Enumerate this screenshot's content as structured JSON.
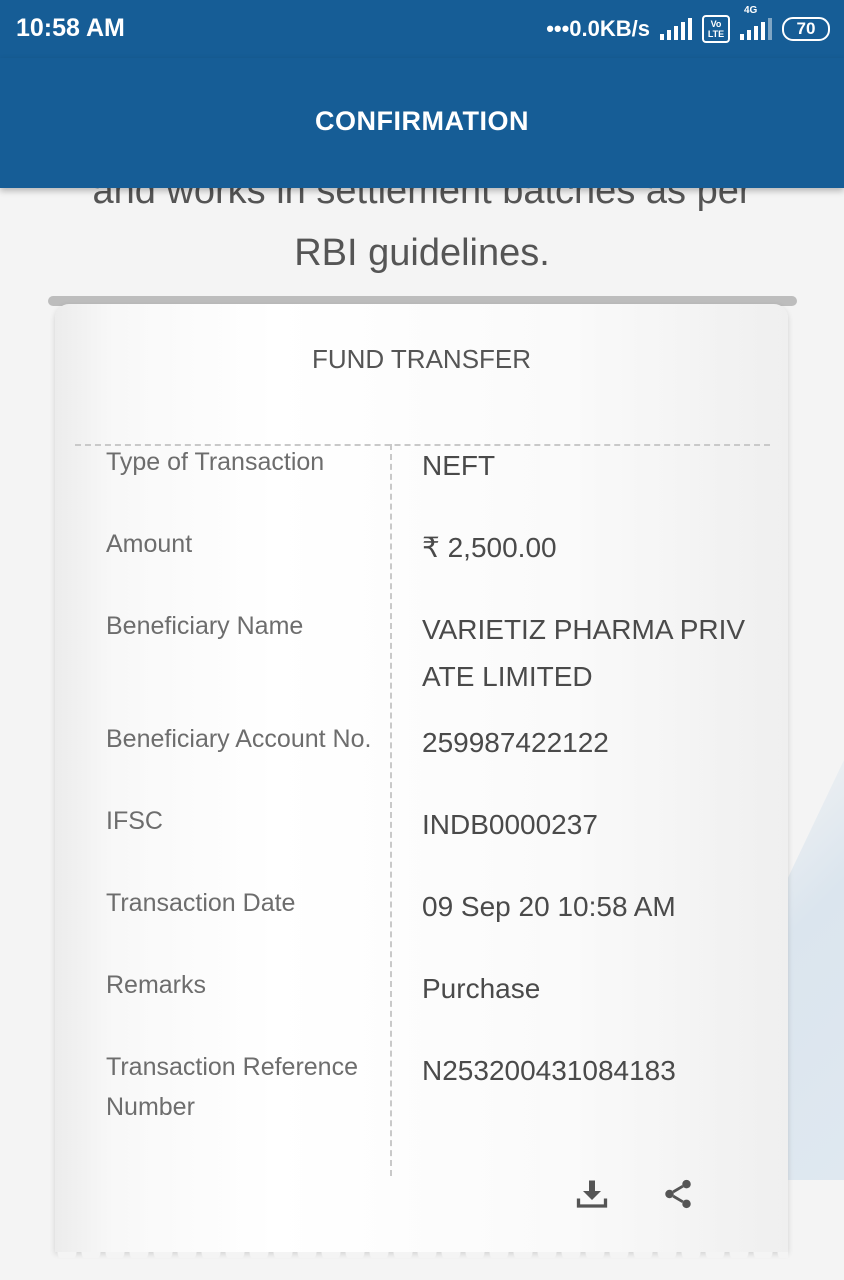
{
  "status_bar": {
    "time": "10:58 AM",
    "network_speed": "•••0.0KB/s",
    "volte_top": "Vo",
    "volte_bottom": "LTE",
    "network_type": "4G",
    "battery": "70"
  },
  "header": {
    "title": "CONFIRMATION"
  },
  "notice": {
    "line_partial": "and works in settlement batches as per",
    "line_last": "RBI guidelines."
  },
  "receipt": {
    "title": "FUND TRANSFER",
    "rows": [
      {
        "label": "Type of Transaction",
        "value": "NEFT"
      },
      {
        "label": "Amount",
        "value": "₹ 2,500.00"
      },
      {
        "label": "Beneficiary Name",
        "value": "VARIETIZ PHARMA PRIV",
        "value2": "ATE LIMITED"
      },
      {
        "label": "Beneficiary Account No.",
        "value": "259987422122"
      },
      {
        "label": "IFSC",
        "value": "INDB0000237"
      },
      {
        "label": "Transaction Date",
        "value": "09 Sep 20 10:58 AM"
      },
      {
        "label": "Remarks",
        "value": "Purchase"
      },
      {
        "label": "Transaction Reference",
        "label2": "Number",
        "value": "N253200431084183"
      }
    ],
    "actions": {
      "download_icon": "download-icon",
      "share_icon": "share-icon"
    }
  }
}
